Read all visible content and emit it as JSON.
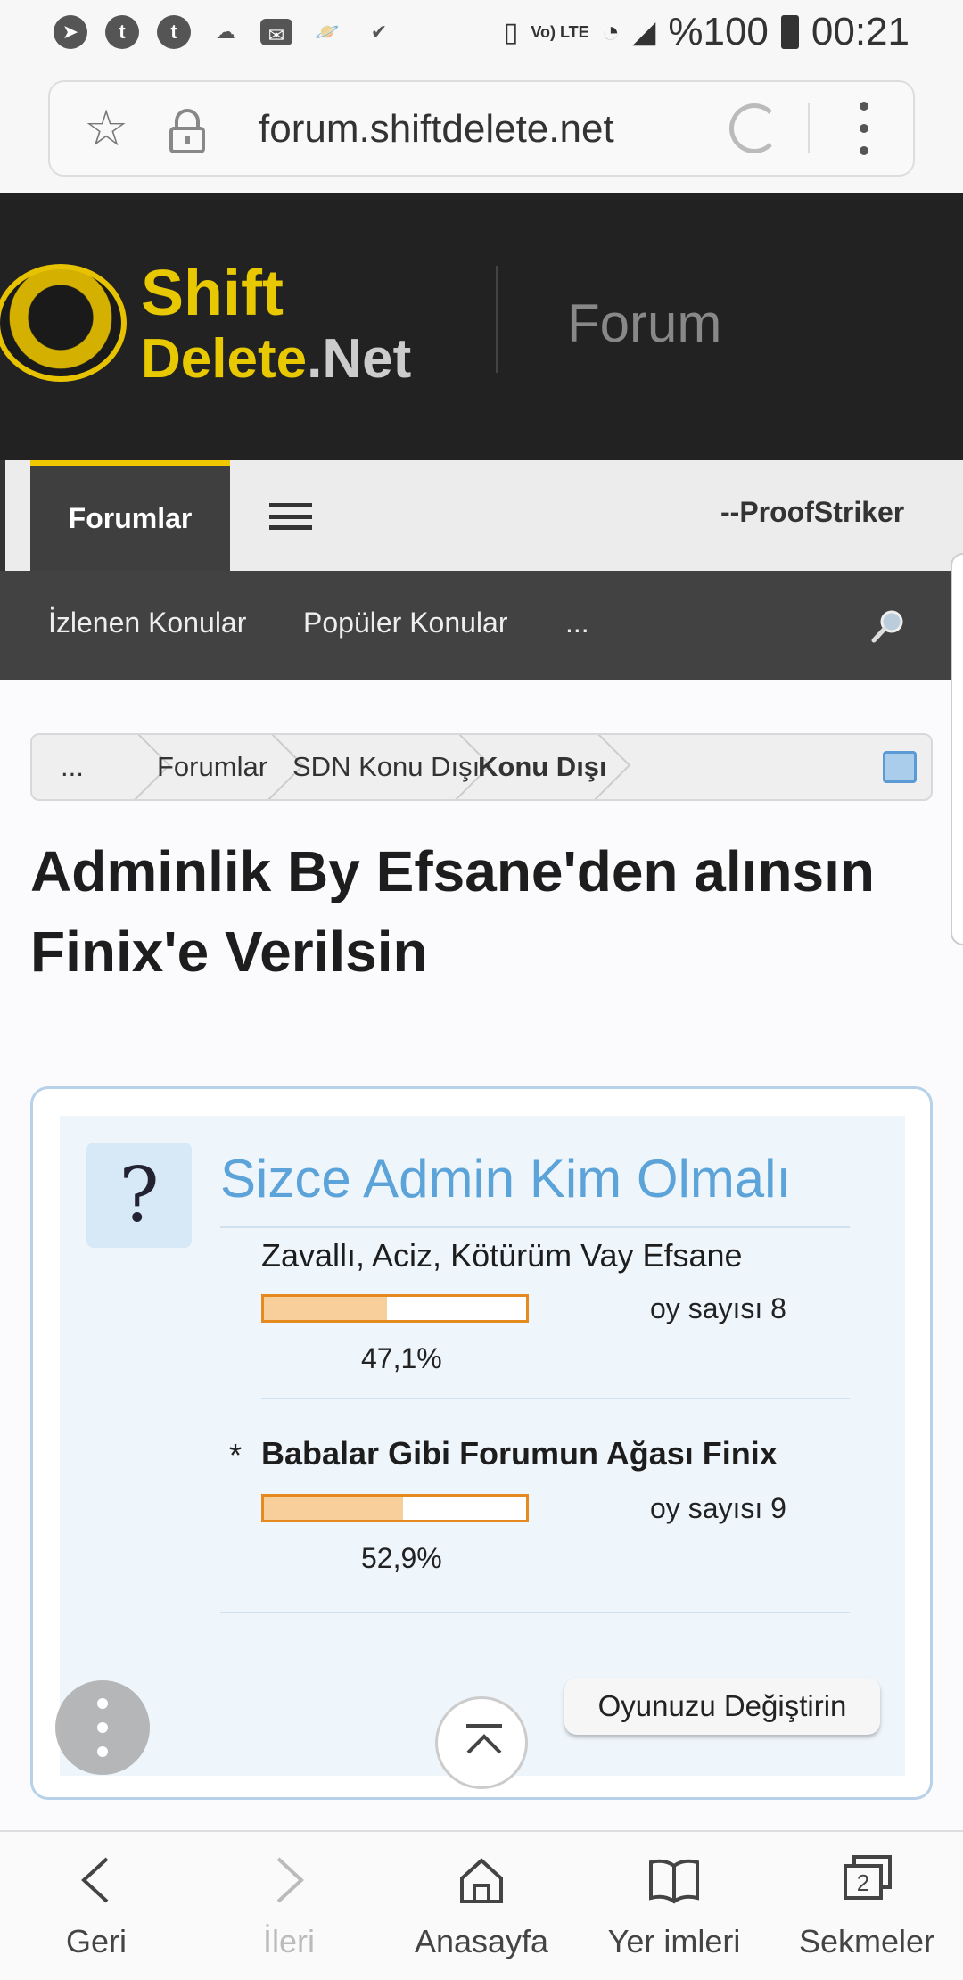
{
  "status_bar": {
    "battery_text": "%100",
    "time": "00:21",
    "network": "Vo) LTE"
  },
  "browser": {
    "url": "forum.shiftdelete.net"
  },
  "header": {
    "logo_line1": "Shift",
    "logo_line2_a": "Delete",
    "logo_line2_b": ".Net",
    "section": "Forum"
  },
  "tabs": {
    "active": "Forumlar",
    "user": "--ProofStriker"
  },
  "sub_nav": {
    "items": [
      "İzlenen Konular",
      "Popüler Konular",
      "..."
    ]
  },
  "breadcrumb": {
    "items": [
      "...",
      "Forumlar",
      "SDN Konu Dışı",
      "Konu Dışı"
    ]
  },
  "thread": {
    "title_line1": "Adminlik By Efsane'den alınsın",
    "title_line2": "Finix'e Verilsin"
  },
  "poll": {
    "question_icon": "?",
    "title": "Sizce Admin Kim Olmalı",
    "options": [
      {
        "label": "Zavallı, Aciz, Kötürüm Vay Efsane",
        "votes_text": "oy sayısı 8",
        "percent_text": "47,1%",
        "percent": 47.1,
        "marker": ""
      },
      {
        "label": "Babalar Gibi Forumun Ağası Finix",
        "votes_text": "oy sayısı 9",
        "percent_text": "52,9%",
        "percent": 52.9,
        "marker": "*"
      }
    ],
    "change_vote_label": "Oyunuzu Değiştirin"
  },
  "bottom_nav": {
    "back": "Geri",
    "forward": "İleri",
    "home": "Anasayfa",
    "bookmarks": "Yer imleri",
    "tabs": "Sekmeler",
    "tabs_count": "2"
  }
}
